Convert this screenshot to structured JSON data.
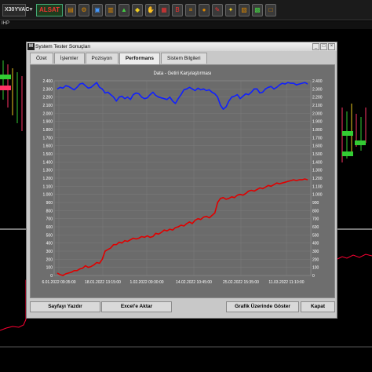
{
  "toolbar": {
    "symbol": "X30YVAC",
    "trade_label": "ALSAT",
    "icons": [
      "folder-icon",
      "settings-icon",
      "save-icon",
      "print-icon",
      "chart-icon",
      "indicator-icon",
      "handshake-icon",
      "grid-icon",
      "bold-icon",
      "list-icon",
      "bell-icon",
      "edit-icon",
      "pin-icon",
      "calc-icon",
      "layout-icon",
      "window-icon"
    ]
  },
  "sub_bar": {
    "label": "IHP"
  },
  "colors": {
    "gain_line": "#e00000",
    "price_line": "#1020ff",
    "panel_bg": "#6e6e6e",
    "ohlc_up": "#33cc33",
    "ohlc_down": "#ff3366"
  },
  "dialog": {
    "title": "System Tester Sonuçları",
    "logo": "M",
    "tabs": [
      {
        "label": "Özet"
      },
      {
        "label": "İşlemler"
      },
      {
        "label": "Pozisyon"
      },
      {
        "label": "Performans"
      },
      {
        "label": "Sistem Bilgileri"
      }
    ],
    "buttons": {
      "print": "Sayfayı Yazdır",
      "excel": "Excel'e Aktar",
      "show_chart": "Grafik Üzerinde Göster",
      "close": "Kapat"
    }
  },
  "chart_data": {
    "type": "line",
    "title": "Data - Getiri Karşılaştırması",
    "x_ticks": [
      "6.01.2022 09:35:00",
      "18.01.2022 13:15:00",
      "1.02.2022 09:30:00",
      "14.02.2022 10:45:00",
      "25.02.2022 15:35:00",
      "11.03.2022 11:10:00"
    ],
    "y_left_ticks": [
      "2.400",
      "2.300",
      "2.200",
      "2.100",
      "2.000",
      "1.900",
      "1.800",
      "1.700",
      "1.600",
      "1.500",
      "1.400",
      "1.300",
      "1.200",
      "1.100",
      "1.000",
      "900",
      "800",
      "700",
      "600",
      "500",
      "400",
      "300",
      "200",
      "100",
      "0"
    ],
    "y_right_ticks": [
      "2.400",
      "2.300",
      "2.200",
      "2.100",
      "2.000",
      "1.900",
      "1.800",
      "1.700",
      "1.600",
      "1.500",
      "1.400",
      "1.300",
      "1.200",
      "1.100",
      "1.000",
      "900",
      "800",
      "700",
      "600",
      "500",
      "400",
      "300",
      "200",
      "100",
      "0"
    ],
    "ylim": [
      0,
      2400
    ],
    "series": [
      {
        "color": "#1020ff",
        "values": [
          2300,
          2320,
          2310,
          2340,
          2330,
          2310,
          2290,
          2320,
          2360,
          2370,
          2340,
          2310,
          2320,
          2350,
          2380,
          2320,
          2300,
          2250,
          2260,
          2230,
          2200,
          2150,
          2200,
          2210,
          2180,
          2200,
          2170,
          2230,
          2250,
          2240,
          2200,
          2180,
          2190,
          2230,
          2260,
          2220,
          2200,
          2190,
          2180,
          2170,
          2200,
          2150,
          2120,
          2180,
          2230,
          2290,
          2300,
          2320,
          2300,
          2280,
          2310,
          2290,
          2300,
          2280,
          2290,
          2260,
          2240,
          2200,
          2100,
          2050,
          2080,
          2150,
          2200,
          2210,
          2230,
          2180,
          2210,
          2240,
          2230,
          2260,
          2300,
          2300,
          2250,
          2260,
          2300,
          2320,
          2330,
          2300,
          2320,
          2350,
          2370,
          2360,
          2380,
          2370,
          2370,
          2350,
          2360,
          2370,
          2380,
          2360
        ]
      },
      {
        "color": "#e00000",
        "values": [
          30,
          10,
          0,
          20,
          30,
          40,
          60,
          60,
          80,
          90,
          120,
          100,
          110,
          130,
          160,
          150,
          200,
          300,
          320,
          340,
          380,
          380,
          410,
          400,
          430,
          420,
          440,
          460,
          450,
          460,
          480,
          470,
          490,
          470,
          480,
          520,
          510,
          530,
          560,
          550,
          570,
          560,
          590,
          600,
          620,
          610,
          640,
          660,
          640,
          680,
          700,
          690,
          720,
          730,
          710,
          740,
          770,
          900,
          950,
          960,
          940,
          950,
          970,
          960,
          990,
          1000,
          990,
          1010,
          1040,
          1050,
          1040,
          1060,
          1080,
          1070,
          1090,
          1110,
          1100,
          1120,
          1140,
          1130,
          1140,
          1150,
          1160,
          1170,
          1180,
          1170,
          1180,
          1180,
          1190,
          1180
        ]
      }
    ],
    "grid": true
  }
}
